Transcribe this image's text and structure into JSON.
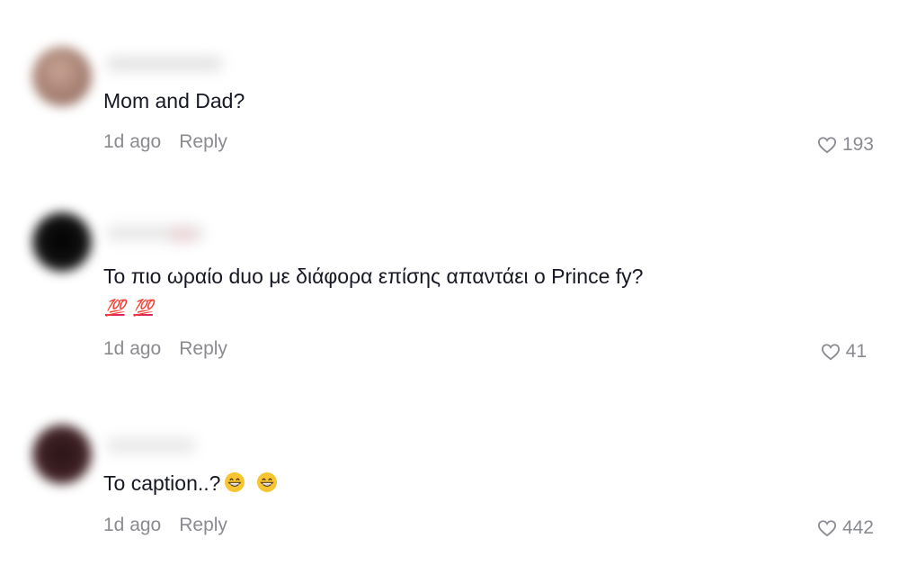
{
  "comments": [
    {
      "text": "Mom and Dad?",
      "time": "1d ago",
      "reply_label": "Reply",
      "likes": "193",
      "avatar_color": "#b08d7e"
    },
    {
      "text": "Το πιο ωραίο duo με διάφορα επίσης απαντάει ο Prince fy?",
      "emoji_line": [
        "💯",
        "💯"
      ],
      "time": "1d ago",
      "reply_label": "Reply",
      "likes": "41",
      "avatar_color": "#111111"
    },
    {
      "text": "Το caption..?",
      "emojis": [
        "grinning-face-emoji",
        "grinning-face-emoji"
      ],
      "time": "1d ago",
      "reply_label": "Reply",
      "likes": "442",
      "avatar_color": "#3a1e22"
    }
  ],
  "icons": {
    "like": "heart-outline-icon"
  }
}
